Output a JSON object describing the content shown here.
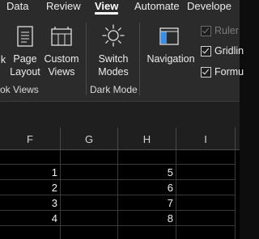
{
  "tabs": [
    "Data",
    "Review",
    "View",
    "Automate",
    "Develope"
  ],
  "active_tab": "View",
  "ribbon": {
    "workbook_views": {
      "group_label": "ok Views",
      "buttons": [
        {
          "line1": "k",
          "line2": ""
        },
        {
          "line1": "Page",
          "line2": "Layout"
        },
        {
          "line1": "Custom",
          "line2": "Views"
        }
      ]
    },
    "dark_mode": {
      "group_label": "Dark Mode",
      "switch_modes": {
        "line1": "Switch",
        "line2": "Modes"
      }
    },
    "navigation_label": "Navigation",
    "show": [
      {
        "label": "Ruler",
        "checked": true,
        "disabled": true
      },
      {
        "label": "Gridlin",
        "checked": true,
        "disabled": false
      },
      {
        "label": "Formu",
        "checked": true,
        "disabled": false
      }
    ]
  },
  "columns": [
    "F",
    "G",
    "H",
    "I"
  ],
  "rows": [
    {
      "F": "1",
      "G": "",
      "H": "5",
      "I": ""
    },
    {
      "F": "2",
      "G": "",
      "H": "6",
      "I": ""
    },
    {
      "F": "3",
      "G": "",
      "H": "7",
      "I": ""
    },
    {
      "F": "4",
      "G": "",
      "H": "8",
      "I": ""
    }
  ],
  "colors": {
    "accent": "#3b8ee8",
    "background": "#000000",
    "ribbon": "#2b2b2b"
  }
}
